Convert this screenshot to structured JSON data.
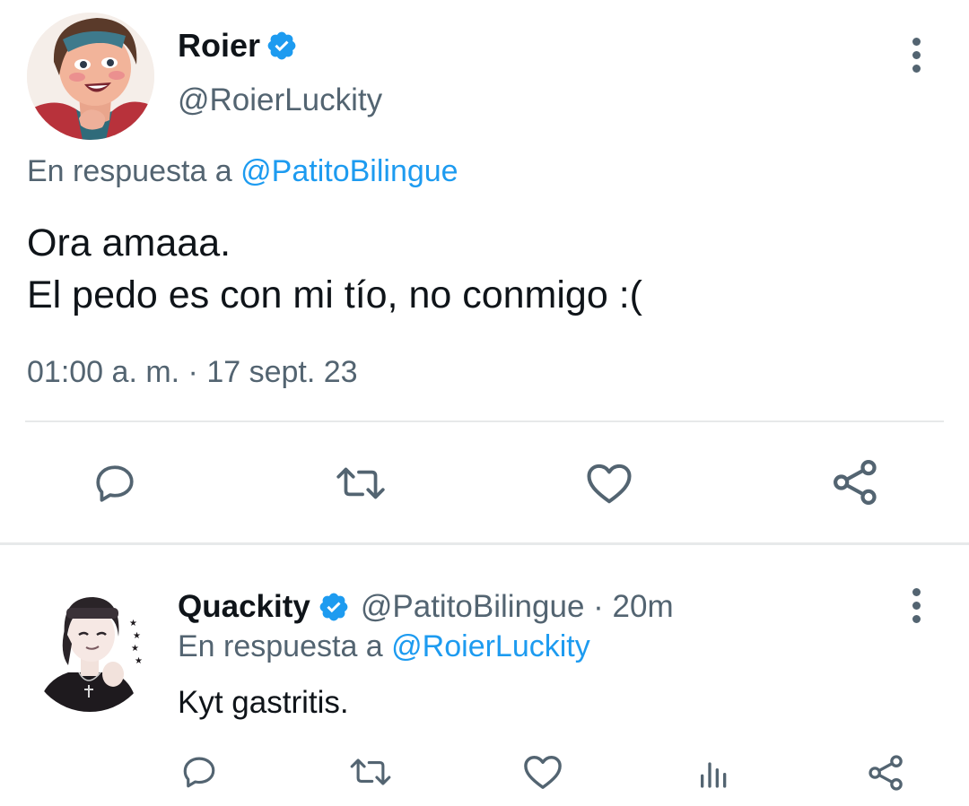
{
  "main_tweet": {
    "author_name": "Roier",
    "handle": "@RoierLuckity",
    "reply_prefix": "En respuesta a",
    "reply_to": "@PatitoBilingue",
    "text_line1": "Ora amaaa.",
    "text_line2": "El pedo es con mi tío, no conmigo :(",
    "timestamp": "01:00 a. m. · 17 sept. 23",
    "actions": [
      "reply-icon",
      "retweet-icon",
      "like-icon",
      "share-icon"
    ]
  },
  "reply_tweet": {
    "author_name": "Quackity",
    "handle_time": "@PatitoBilingue · 20m",
    "reply_prefix": "En respuesta a",
    "reply_to": "@RoierLuckity",
    "text": "Kyt gastritis.",
    "actions": [
      "reply-icon",
      "retweet-icon",
      "like-icon",
      "views-icon",
      "share-icon"
    ]
  },
  "colors": {
    "accent": "#1d9bf0",
    "muted": "#536471",
    "divider": "#e7e9ea"
  }
}
